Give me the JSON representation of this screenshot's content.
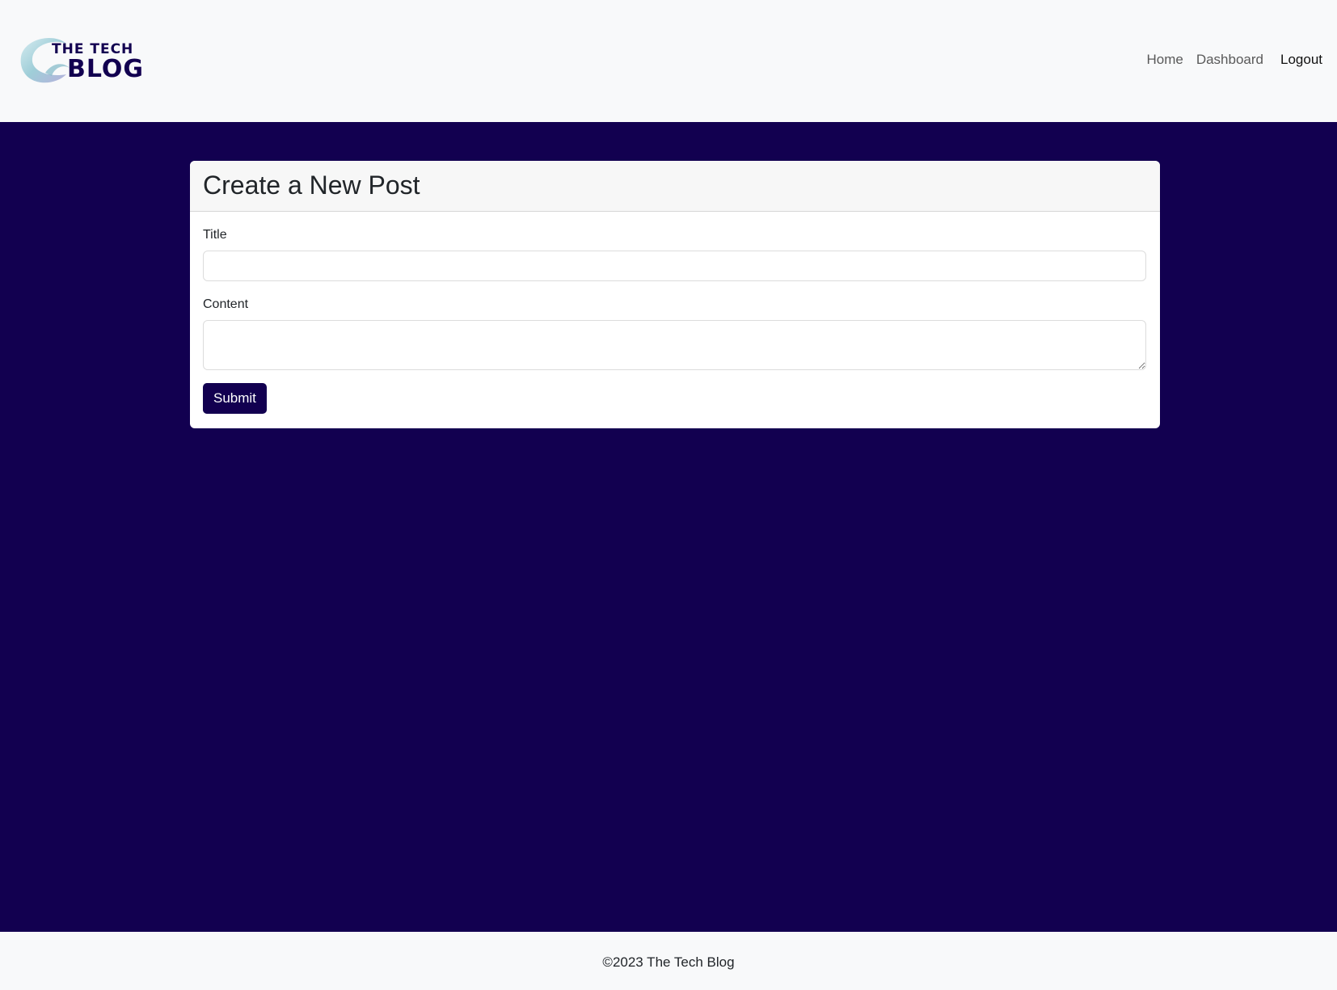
{
  "header": {
    "logo": {
      "line1": "THE TECH",
      "line2": "BLOG"
    },
    "nav": [
      {
        "label": "Home"
      },
      {
        "label": "Dashboard"
      },
      {
        "label": "Logout"
      }
    ]
  },
  "form": {
    "heading": "Create a New Post",
    "title_label": "Title",
    "title_value": "",
    "content_label": "Content",
    "content_value": "",
    "submit_label": "Submit"
  },
  "footer": {
    "text": "©2023 The Tech Blog"
  },
  "colors": {
    "brand": "#120050",
    "nav_background": "#f8f9fa",
    "card_header": "#f7f7f7"
  }
}
